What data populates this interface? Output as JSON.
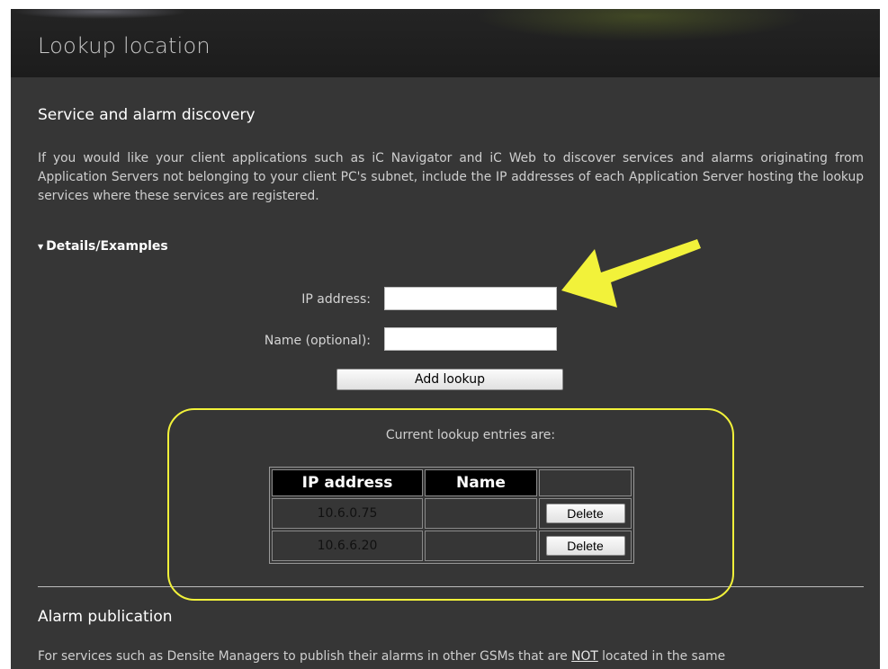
{
  "header": {
    "title": "Lookup location"
  },
  "discovery": {
    "heading": "Service and alarm discovery",
    "description": "If you would like your client applications such as iC Navigator and iC Web to discover services and alarms originating from Application Servers not belonging to your client PC's subnet, include the IP addresses of each Application Server hosting the lookup services where these services are registered.",
    "details_label": "Details/Examples"
  },
  "form": {
    "ip_label": "IP address:",
    "ip_value": "",
    "name_label": "Name (optional):",
    "name_value": "",
    "add_button": "Add lookup"
  },
  "entries": {
    "caption": "Current lookup entries are:",
    "columns": [
      "IP address",
      "Name"
    ],
    "rows": [
      {
        "ip": "10.6.0.75",
        "name": "",
        "action": "Delete"
      },
      {
        "ip": "10.6.6.20",
        "name": "",
        "action": "Delete"
      }
    ]
  },
  "publication": {
    "heading": "Alarm publication",
    "text_start": "For services such as Densite Managers to publish their alarms in other GSMs that are ",
    "text_emph": "NOT",
    "text_end": " located in the same"
  },
  "colors": {
    "annotation": "#f2f23a",
    "panel": "#363636",
    "header": "#1f1f1f"
  },
  "icons": {
    "details_toggle": "triangle-down",
    "annotation": "arrow-pointing-left"
  }
}
